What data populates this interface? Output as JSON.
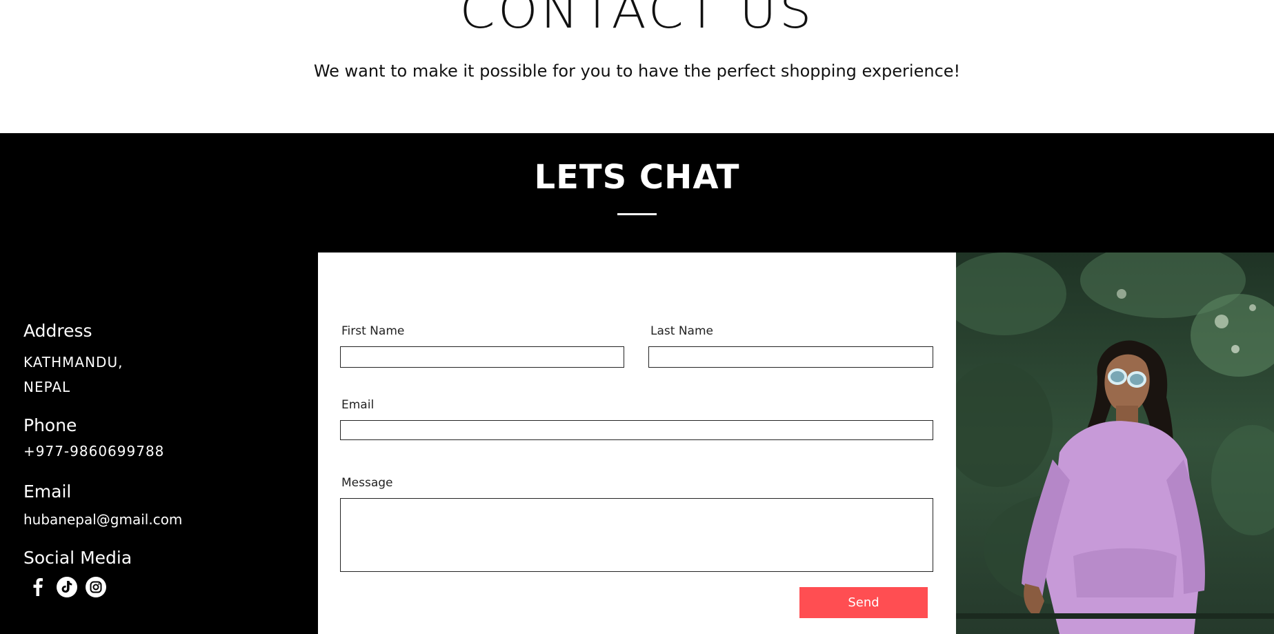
{
  "header": {
    "title": "CONTACT US",
    "subtitle": "We want to make it possible for you to have the perfect shopping experience!"
  },
  "chat": {
    "title": "LETS CHAT"
  },
  "info": {
    "address_heading": "Address",
    "address_line1": "KATHMANDU,",
    "address_line2": "NEPAL",
    "phone_heading": "Phone",
    "phone_value": "+977-9860699788",
    "email_heading": "Email",
    "email_value": "hubanepal@gmail.com",
    "social_heading": "Social Media",
    "social_icons": [
      "facebook-icon",
      "tiktok-icon",
      "instagram-icon"
    ]
  },
  "form": {
    "first_name_label": "First Name",
    "first_name_value": "",
    "last_name_label": "Last Name",
    "last_name_value": "",
    "email_label": "Email",
    "email_value": "",
    "message_label": "Message",
    "message_value": "",
    "send_label": "Send"
  },
  "colors": {
    "band": "#000000",
    "send_button": "#ff4e52",
    "sweatshirt": "#c79ad8",
    "foliage": "#2f4a35"
  }
}
